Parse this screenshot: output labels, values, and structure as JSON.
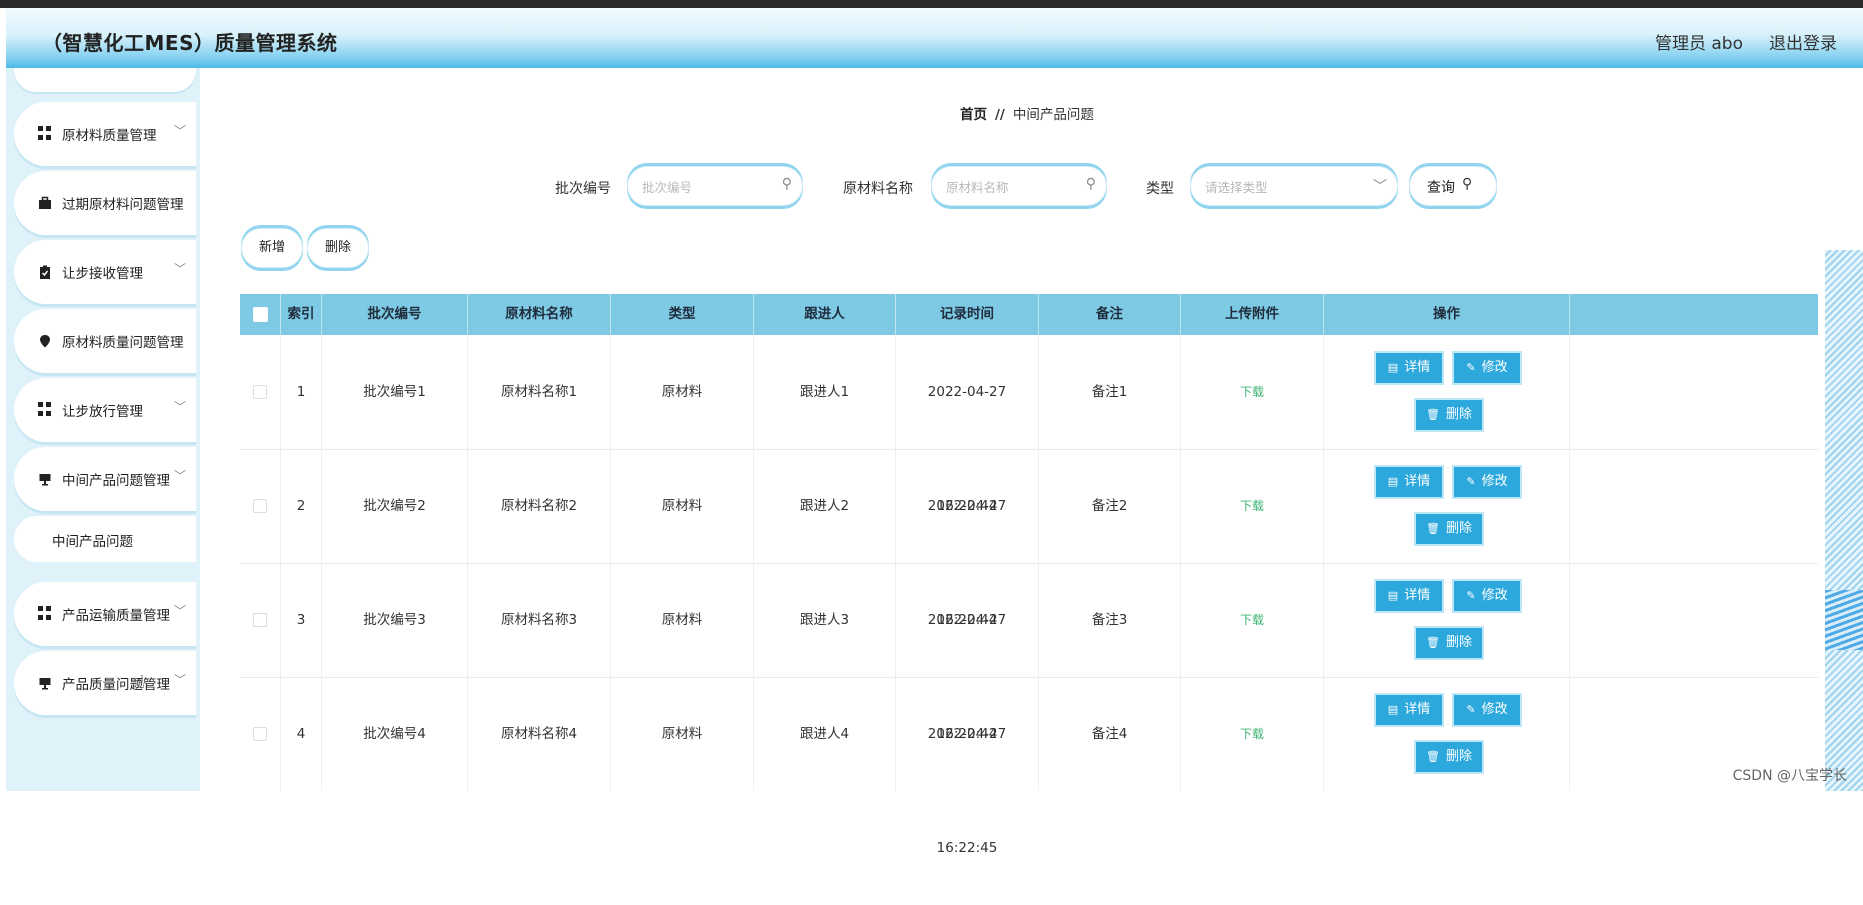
{
  "header": {
    "title": "（智慧化工MES）质量管理系统",
    "user": "管理员 abo",
    "logout": "退出登录"
  },
  "sidebar": {
    "items": [
      {
        "label": "原材料质量管理",
        "icon": "grid-icon",
        "chevron": true
      },
      {
        "label": "过期原材料问题管理",
        "icon": "briefcase-icon",
        "chevron": false
      },
      {
        "label": "让步接收管理",
        "icon": "clipboard-icon",
        "chevron": true
      },
      {
        "label": "原材料质量问题管理",
        "icon": "location-pin-icon",
        "chevron": false
      },
      {
        "label": "让步放行管理",
        "icon": "grid-icon",
        "chevron": true
      },
      {
        "label": "中间产品问题管理",
        "icon": "monitor-icon",
        "chevron": true
      },
      {
        "label": "产品运输质量管理",
        "icon": "grid-icon",
        "chevron": true
      },
      {
        "label": "产品质量问题管理",
        "icon": "monitor-icon",
        "chevron": true
      }
    ],
    "subitem": "中间产品问题"
  },
  "breadcrumb": {
    "home": "首页",
    "separator": "//",
    "current": "中间产品问题"
  },
  "search": {
    "batch_label": "批次编号",
    "batch_placeholder": "批次编号",
    "material_label": "原材料名称",
    "material_placeholder": "原材料名称",
    "type_label": "类型",
    "type_placeholder": "请选择类型",
    "query_button": "查询"
  },
  "actions": {
    "add": "新增",
    "delete": "删除"
  },
  "table": {
    "columns": [
      "索引",
      "批次编号",
      "原材料名称",
      "类型",
      "跟进人",
      "记录时间",
      "备注",
      "上传附件",
      "操作"
    ],
    "rows": [
      {
        "index": "1",
        "batch": "批次编号1",
        "material": "原材料名称1",
        "type": "原材料",
        "follower": "跟进人1",
        "time": "2022-04-27 16:22:44",
        "remark": "备注1",
        "attachment": "下载"
      },
      {
        "index": "2",
        "batch": "批次编号2",
        "material": "原材料名称2",
        "type": "原材料",
        "follower": "跟进人2",
        "time": "2022-04-27 16:22:44",
        "remark": "备注2",
        "attachment": "下载"
      },
      {
        "index": "3",
        "batch": "批次编号3",
        "material": "原材料名称3",
        "type": "原材料",
        "follower": "跟进人3",
        "time": "2022-04-27 16:22:44",
        "remark": "备注3",
        "attachment": "下载"
      },
      {
        "index": "4",
        "batch": "批次编号4",
        "material": "原材料名称4",
        "type": "原材料",
        "follower": "跟进人4",
        "time": "2022-04-27 16:22:45",
        "remark": "备注4",
        "attachment": "下载"
      }
    ],
    "op_labels": {
      "detail": "详情",
      "edit": "修改",
      "delete": "删除"
    }
  },
  "watermark": "CSDN @八宝学长",
  "colors": {
    "header_accent": "#4bb8e6",
    "table_header": "#7ec9e3",
    "op_button": "#2da8dc",
    "download_link": "#3cb371"
  }
}
